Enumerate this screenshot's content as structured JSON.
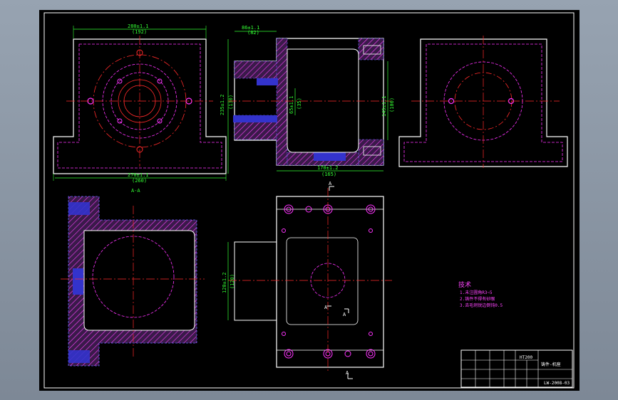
{
  "colors": {
    "outline": "#ffffff",
    "center": "#ff2a2a",
    "hidden": "#ff33ff",
    "dim": "#33ff33",
    "hatch": "#ff44ff",
    "fill": "#3333cc",
    "note": "#ff44ff"
  },
  "top_view": {
    "dim_top": "280±1.1",
    "dim_top_sub": "(192)",
    "dim_left": "235±1.2",
    "dim_left_sub": "(130)",
    "dim_bottom": "270±1.1",
    "dim_bottom_sub": "(260)",
    "label": "A-A"
  },
  "side_view": {
    "dim_top": "86±1.1",
    "dim_top_sub": "(82)",
    "dim_mid": "65±1.1",
    "dim_mid_sub": "(35)",
    "dim_right": "145±1.1",
    "dim_right_sub": "(100)",
    "dim_bottom": "170±1.2",
    "dim_bottom_sub": "(165)"
  },
  "plan_view": {
    "dim_left": "120±1.2",
    "dim_left_sub": "(120)",
    "section_a": "A"
  },
  "notes": {
    "title": "技术",
    "line1": "1.未注圆角R3~5",
    "line2": "2.铸件不得有砂眼",
    "line3": "3.去毛刺锐边倒钝0.5"
  },
  "title_block": {
    "material": "HT200",
    "part_name": "铸件-机座",
    "drawing_no": "LW-2008-03"
  }
}
